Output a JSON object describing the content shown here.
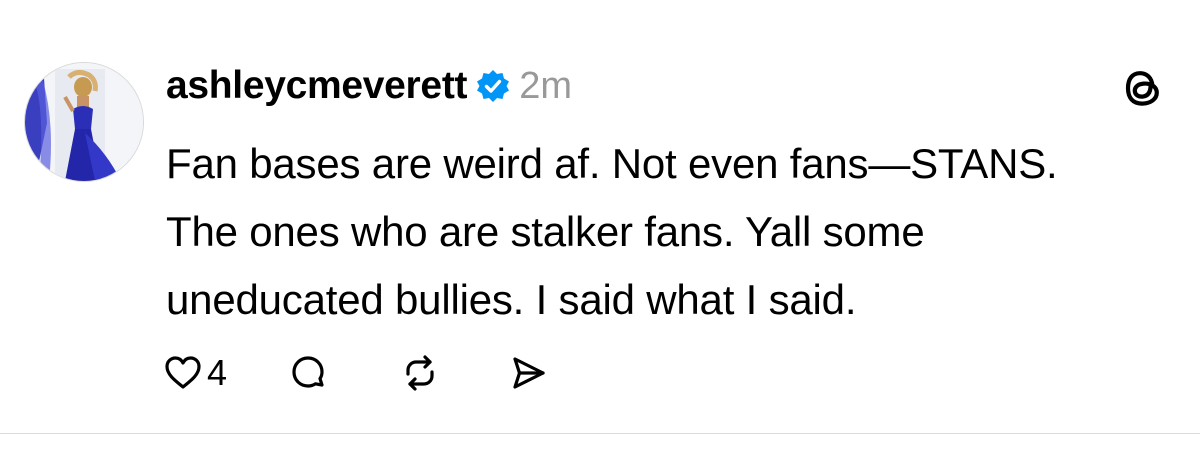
{
  "post": {
    "username": "ashleycmeverett",
    "timestamp": "2m",
    "body_lines": [
      "Fan bases are weird af. Not even fans—STANS.",
      "The ones who are stalker fans. Yall some",
      "uneducated bullies. I said what I said."
    ],
    "like_count": "4"
  },
  "icons": {
    "verified": "verified-badge-icon",
    "app_logo": "threads-logo-icon",
    "like": "heart-icon",
    "reply": "comment-bubble-icon",
    "repost": "repost-icon",
    "share": "send-icon"
  },
  "colors": {
    "verified_blue": "#0095F6",
    "timestamp_gray": "#999999",
    "divider": "#DCDCDC"
  }
}
